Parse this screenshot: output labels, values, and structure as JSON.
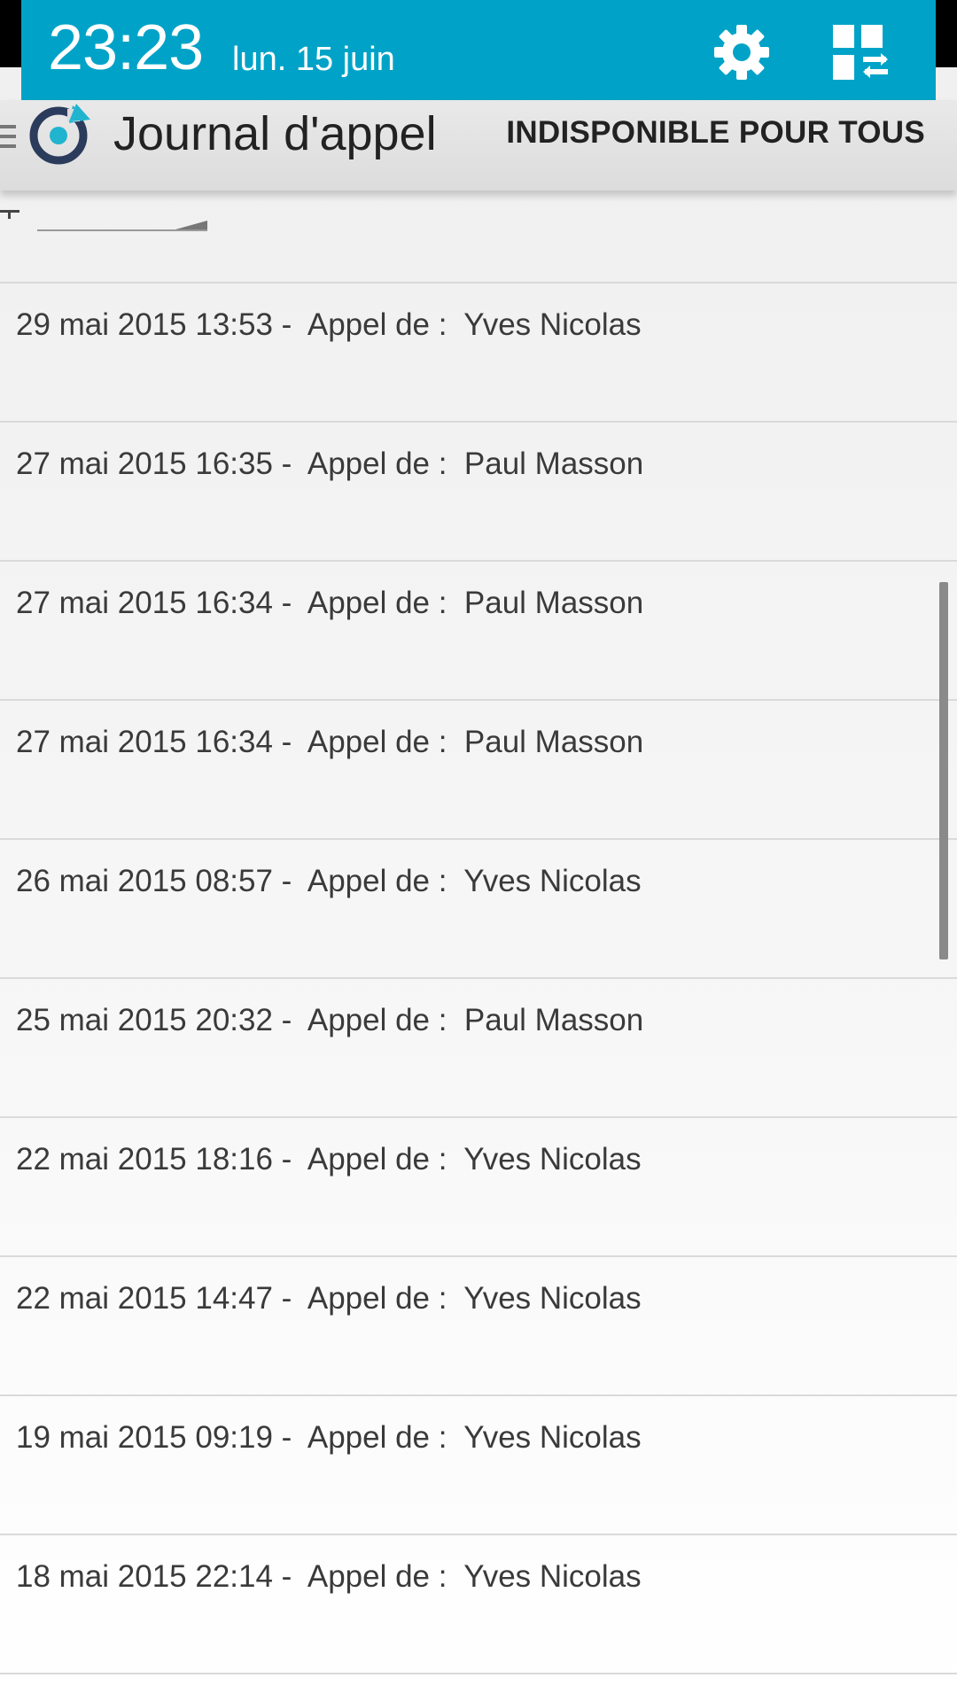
{
  "status": {
    "time": "23:23",
    "date": "lun. 15 juin"
  },
  "app": {
    "title": "Journal d'appel",
    "action_label": "INDISPONIBLE POUR TOUS"
  },
  "icons": {
    "settings": "gear-icon",
    "quick_settings": "quick-settings-icon",
    "menu": "hamburger-menu-icon",
    "logo": "app-logo-icon"
  },
  "colors": {
    "notification_bg": "#00a3c7",
    "actionbar_bg": "#dcdcdc"
  },
  "calls": [
    {
      "text": "29 mai 2015 13:53 -  Appel de :  Yves Nicolas"
    },
    {
      "text": "27 mai 2015 16:35 -  Appel de :  Paul Masson"
    },
    {
      "text": "27 mai 2015 16:34 -  Appel de :  Paul Masson"
    },
    {
      "text": "27 mai 2015 16:34 -  Appel de :  Paul Masson"
    },
    {
      "text": "26 mai 2015 08:57 -  Appel de :  Yves Nicolas"
    },
    {
      "text": "25 mai 2015 20:32 -  Appel de :  Paul Masson"
    },
    {
      "text": "22 mai 2015 18:16 -  Appel de :  Yves Nicolas"
    },
    {
      "text": "22 mai 2015 14:47 -  Appel de :  Yves Nicolas"
    },
    {
      "text": "19 mai 2015 09:19 -  Appel de :  Yves Nicolas"
    },
    {
      "text": "18 mai 2015 22:14 -  Appel de :  Yves Nicolas"
    }
  ]
}
